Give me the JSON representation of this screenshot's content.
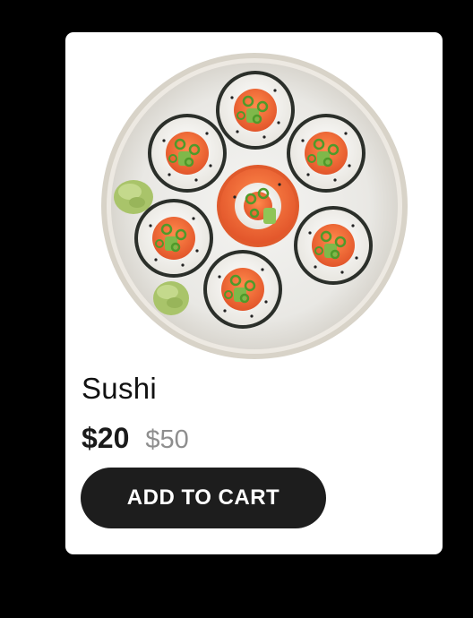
{
  "product": {
    "name": "Sushi",
    "price": "$20",
    "original_price": "$50",
    "image_icon": "sushi-plate-image"
  },
  "actions": {
    "add_to_cart_label": "ADD TO CART"
  },
  "colors": {
    "page_background": "#000000",
    "card_background": "#ffffff",
    "button_background": "#1d1d1d",
    "button_text": "#ffffff",
    "price_original": "#8e8e8e"
  }
}
